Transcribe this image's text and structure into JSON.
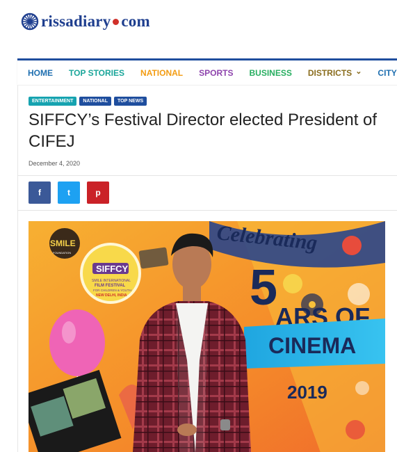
{
  "site": {
    "logo_part1": "rissadiary",
    "logo_part2": "com",
    "brand_color": "#1f3f8f",
    "dot_color": "#d0302a"
  },
  "nav": [
    {
      "label": "HOME",
      "color": "#1f6fb0"
    },
    {
      "label": "TOP STORIES",
      "color": "#1aa69a"
    },
    {
      "label": "NATIONAL",
      "color": "#f39c12"
    },
    {
      "label": "SPORTS",
      "color": "#8e44ad"
    },
    {
      "label": "BUSINESS",
      "color": "#27ae60"
    },
    {
      "label": "DISTRICTS",
      "color": "#8a6d1e",
      "has_dropdown": true
    },
    {
      "label": "CITY",
      "color": "#1f6fb0",
      "has_dropdown": true
    }
  ],
  "article": {
    "tags": [
      {
        "label": "ENTERTAINMENT",
        "color": "#16a3b0"
      },
      {
        "label": "NATIONAL",
        "color": "#1f4e9e"
      },
      {
        "label": "TOP NEWS",
        "color": "#1f4e9e"
      }
    ],
    "title": "SIFFCY’s Festival Director elected President of CIFEJ",
    "date": "December 4, 2020"
  },
  "share": [
    {
      "network": "facebook-icon",
      "glyph": "f",
      "color": "#3b5998"
    },
    {
      "network": "twitter-icon",
      "glyph": "t",
      "color": "#1da1f2"
    },
    {
      "network": "pinterest-icon",
      "glyph": "p",
      "color": "#ca2127"
    }
  ],
  "hero": {
    "logo_text": "SMILE",
    "logo_sub": "FOUNDATION",
    "festival_name": "SIFFCY",
    "festival_sub1": "SMILE INTERNATIONAL",
    "festival_sub2": "FILM FESTIVAL",
    "festival_sub3": "FOR CHILDREN & YOUTH",
    "festival_sub4": "NEW DELHI, INDIA",
    "banner_celebrating": "Celebrating",
    "banner_number": "5",
    "banner_years_of": "ARS OF",
    "banner_cinema": "CINEMA",
    "banner_year": "2019",
    "bg_color": "#f5a623"
  }
}
